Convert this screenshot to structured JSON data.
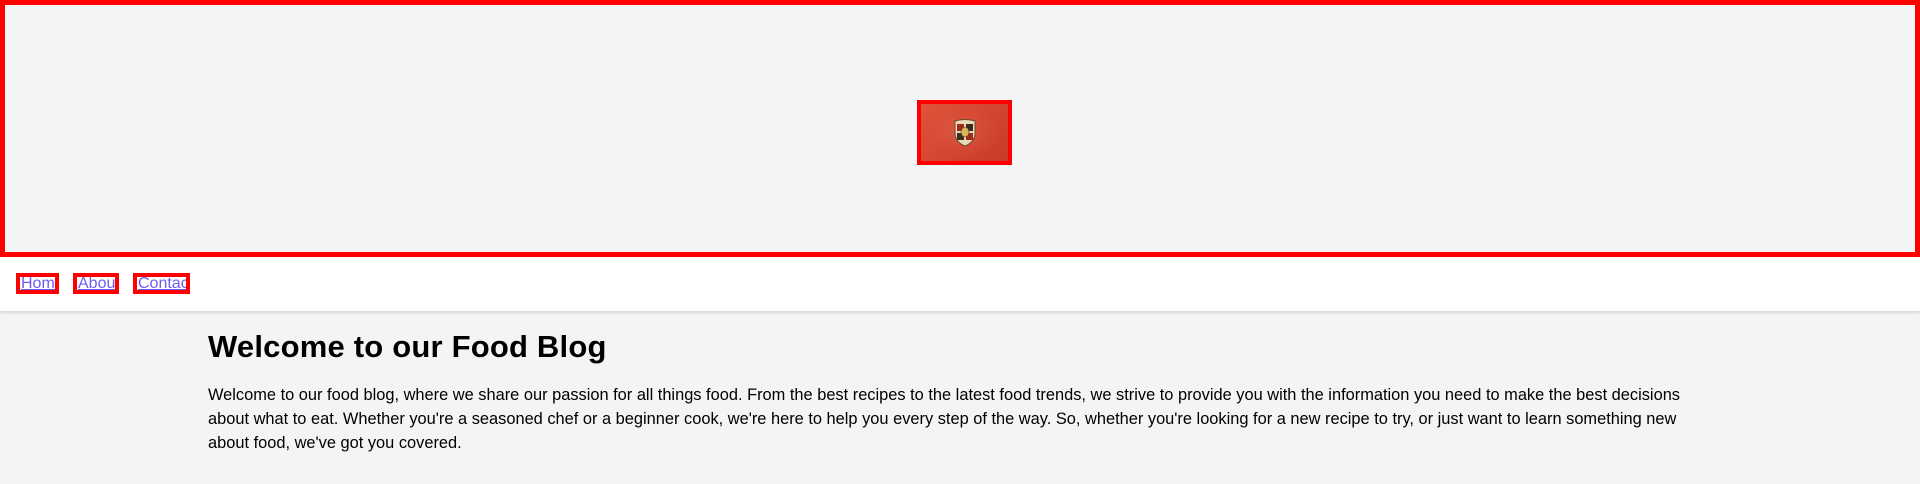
{
  "header": {
    "logo_icon": "crest-logo-icon",
    "logo_color": "#d9432f",
    "border_color": "#ff0000"
  },
  "nav": {
    "links": [
      {
        "label": "Home"
      },
      {
        "label": "About"
      },
      {
        "label": "Contact"
      }
    ],
    "link_color": "#6d5cf0"
  },
  "main": {
    "title": "Welcome to our Food Blog",
    "intro": "Welcome to our food blog, where we share our passion for all things food. From the best recipes to the latest food trends, we strive to provide you with the information you need to make the best decisions about what to eat. Whether you're a seasoned chef or a beginner cook, we're here to help you every step of the way. So, whether you're looking for a new recipe to try, or just want to learn something new about food, we've got you covered."
  }
}
